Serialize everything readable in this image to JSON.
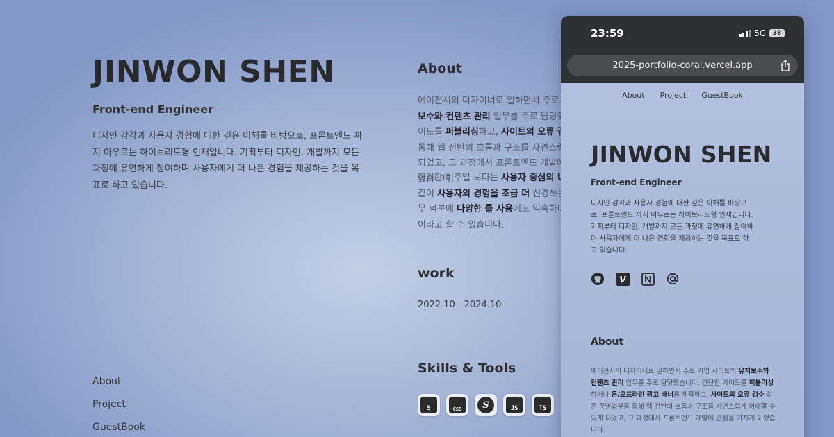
{
  "left": {
    "name": "JINWON SHEN",
    "role": "Front-end Engineer",
    "intro": "디자인 감각과 사용자 경험에 대한 깊은 이해를 바탕으로, 프론트엔드 까지 아우르는 하이브리드형 인재입니다. 기획부터 디자인, 개발까지 모든 과정에 유연하게 참여하며 사용자에게 더 나은 경험을 제공하는 것을 목표로 하고 있습니다.",
    "nav": [
      "About",
      "Project",
      "GuestBook"
    ]
  },
  "middle": {
    "about_title": "About",
    "about_p1": [
      {
        "t": "에이전시의 디자이너로 일하면서 주로 기업 사이트의 "
      },
      {
        "t": "유지보수와 컨텐츠 관리",
        "b": true
      },
      {
        "t": " 업무를 주로 담당했습니다. 간단한 가이드를 "
      },
      {
        "t": "퍼블리싱",
        "b": true
      },
      {
        "t": "하고, "
      },
      {
        "t": "사이트의 오류 검수",
        "b": true
      },
      {
        "t": " 같은 운영업무를 통해 웹 전반의 흐름과 구조를 자연스럽게 이해할 수 있게 되었고, 그 과정에서 프론트엔드 개발에 관심을 가지게 되었습니다."
      }
    ],
    "about_p2": [
      {
        "t": "화려한 비주얼 보다는 "
      },
      {
        "t": "사용자 중심의 UI",
        "b": true
      },
      {
        "t": "와 애니메이션과 같이 "
      },
      {
        "t": "사용자의 경험을 조금 더",
        "b": true
      },
      {
        "t": " 신경쓰는 편이고, 디자인 업무 덕분에 "
      },
      {
        "t": "다양한 툴 사용",
        "b": true
      },
      {
        "t": "에도 익숙하다는 것이 저의 "
      },
      {
        "t": "장점",
        "b": true
      },
      {
        "t": "이라고 할 수 있습니다."
      }
    ],
    "work_title": "work",
    "work_date": "2022.10 - 2024.10",
    "skills_title": "Skills & Tools",
    "skills": [
      {
        "label": "5",
        "icon": "html5-icon"
      },
      {
        "label": "CSS",
        "icon": "css-icon"
      },
      {
        "label": "S",
        "icon": "sass-icon"
      },
      {
        "label": "JS",
        "icon": "javascript-icon"
      },
      {
        "label": "TS",
        "icon": "typescript-icon"
      }
    ]
  },
  "phone": {
    "time": "23:59",
    "network": "5G",
    "battery": "38",
    "url": "2025-portfolio-coral.vercel.app",
    "nav": [
      "About",
      "Project",
      "GuestBook"
    ],
    "name": "JINWON SHEN",
    "role": "Front-end Engineer",
    "intro": "디자인 감각과 사용자 경험에 대한 깊은 이해를 바탕으로, 프론트엔드 까지 아우르는 하이브리드형 인재입니다. 기획부터 디자인, 개발까지 모든 과정에 유연하게 참여하며 사용자에게 더 나은 경험을 제공하는 것을 목표로 하고 있습니다.",
    "social_icons": [
      "github-icon",
      "velog-icon",
      "notion-icon",
      "email-icon"
    ],
    "about_title": "About",
    "about": [
      {
        "t": "에이전시의 디자이너로 일하면서 주로 기업 사이트의 "
      },
      {
        "t": "유지보수와 컨텐츠 관리",
        "b": true
      },
      {
        "t": " 업무를 주로 담당했습니다. 간단한 가이드를 "
      },
      {
        "t": "퍼블리싱",
        "b": true
      },
      {
        "t": "하거나 "
      },
      {
        "t": "온/오프라인 광고 배너",
        "b": true
      },
      {
        "t": "를 제작하고, "
      },
      {
        "t": "사이트의 오류 검수",
        "b": true
      },
      {
        "t": " 같은 운영업무를 통해 웹 전반의 흐름과 구조를 자연스럽게 이해할 수 있게 되었고, 그 과정에서 프론트엔드 개발에 관심을 가지게 되었습니다."
      }
    ]
  }
}
